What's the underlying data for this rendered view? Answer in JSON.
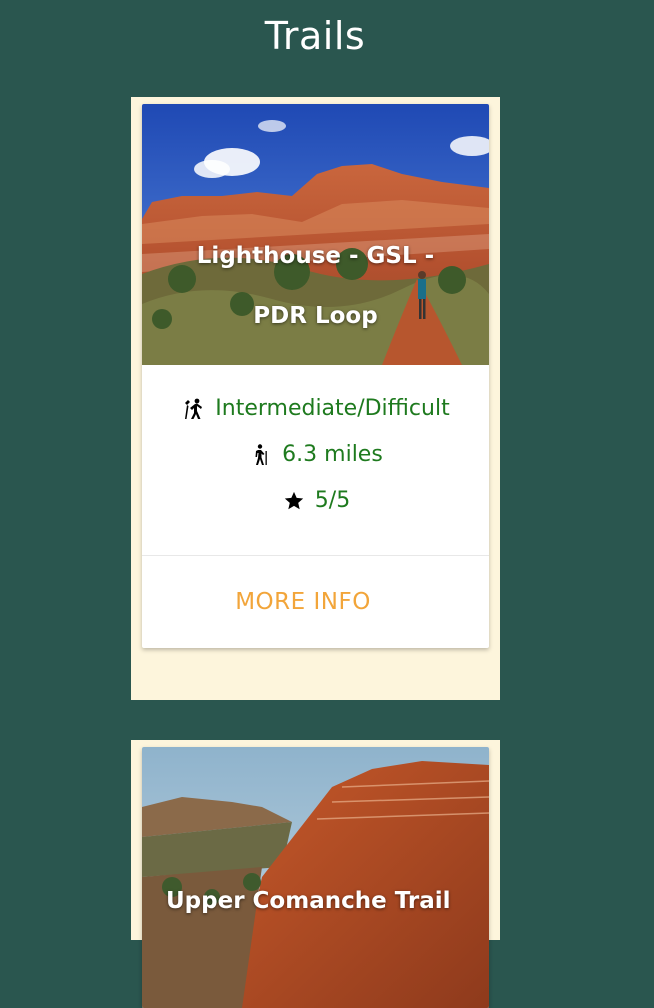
{
  "page": {
    "title": "Trails"
  },
  "trails": [
    {
      "name": "Lighthouse - GSL - PDR Loop",
      "difficulty": "Intermediate/Difficult",
      "distance": "6.3 miles",
      "rating": "5/5",
      "action_label": "MORE INFO"
    },
    {
      "name": "Upper Comanche Trail"
    }
  ],
  "icons": {
    "difficulty": "climber-icon",
    "distance": "hiker-icon",
    "rating": "star-icon"
  },
  "colors": {
    "background": "#2a564f",
    "card_frame": "#fdf5dc",
    "stat_text": "#1e7a1e",
    "action_text": "#f2a53a"
  }
}
